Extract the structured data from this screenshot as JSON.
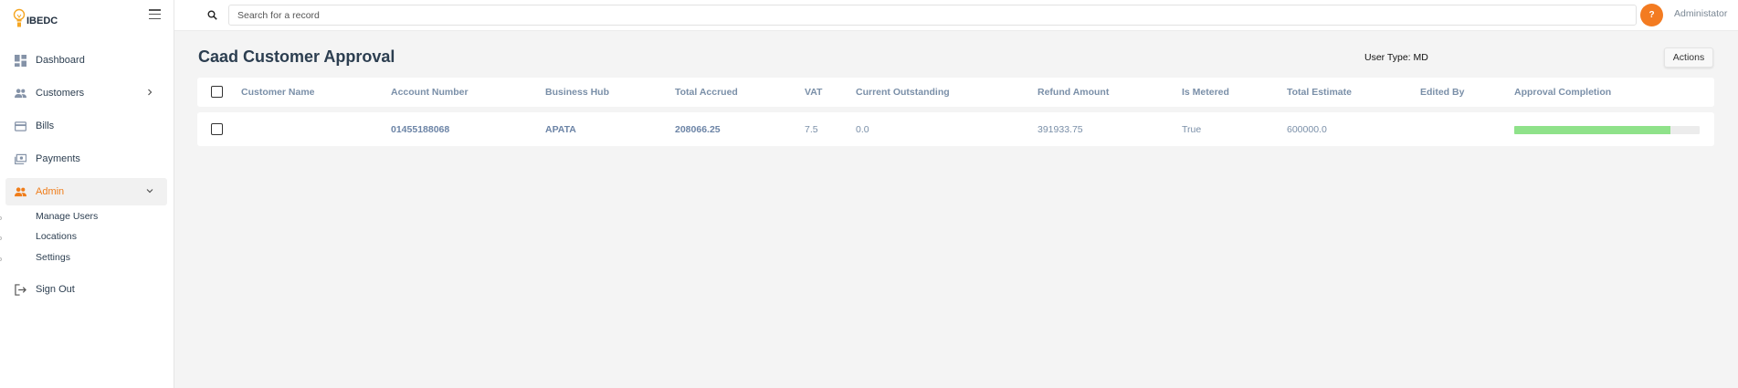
{
  "app": {
    "logo_text": "IBEDC"
  },
  "sidebar": {
    "items": [
      {
        "label": "Dashboard"
      },
      {
        "label": "Customers"
      },
      {
        "label": "Bills"
      },
      {
        "label": "Payments"
      },
      {
        "label": "Admin"
      },
      {
        "label": "Sign Out"
      }
    ],
    "admin_sub_items": [
      {
        "label": "Manage Users"
      },
      {
        "label": "Locations"
      },
      {
        "label": "Settings"
      }
    ]
  },
  "topbar": {
    "search_placeholder": "Search for a record",
    "avatar_text": "?",
    "username": "Administator"
  },
  "page": {
    "title": "Caad Customer Approval",
    "user_type": "User Type: MD",
    "actions_label": "Actions"
  },
  "table": {
    "columns": [
      "Customer Name",
      "Account Number",
      "Business Hub",
      "Total Accrued",
      "VAT",
      "Current Outstanding",
      "Refund Amount",
      "Is Metered",
      "Total Estimate",
      "Edited By",
      "Approval Completion"
    ],
    "rows": [
      {
        "customer_name": "",
        "account_number": "01455188068",
        "business_hub": "APATA",
        "total_accrued": "208066.25",
        "vat": "7.5",
        "current_outstanding": "0.0",
        "refund_amount": "391933.75",
        "is_metered": "True",
        "total_estimate": "600000.0",
        "edited_by": "",
        "approval_completion": 0.84
      }
    ]
  },
  "colors": {
    "accent": "#f37b21",
    "active_nav": "#f07d1a",
    "progress_fill": "#8fe28a",
    "header_text": "#7a8fa8"
  }
}
